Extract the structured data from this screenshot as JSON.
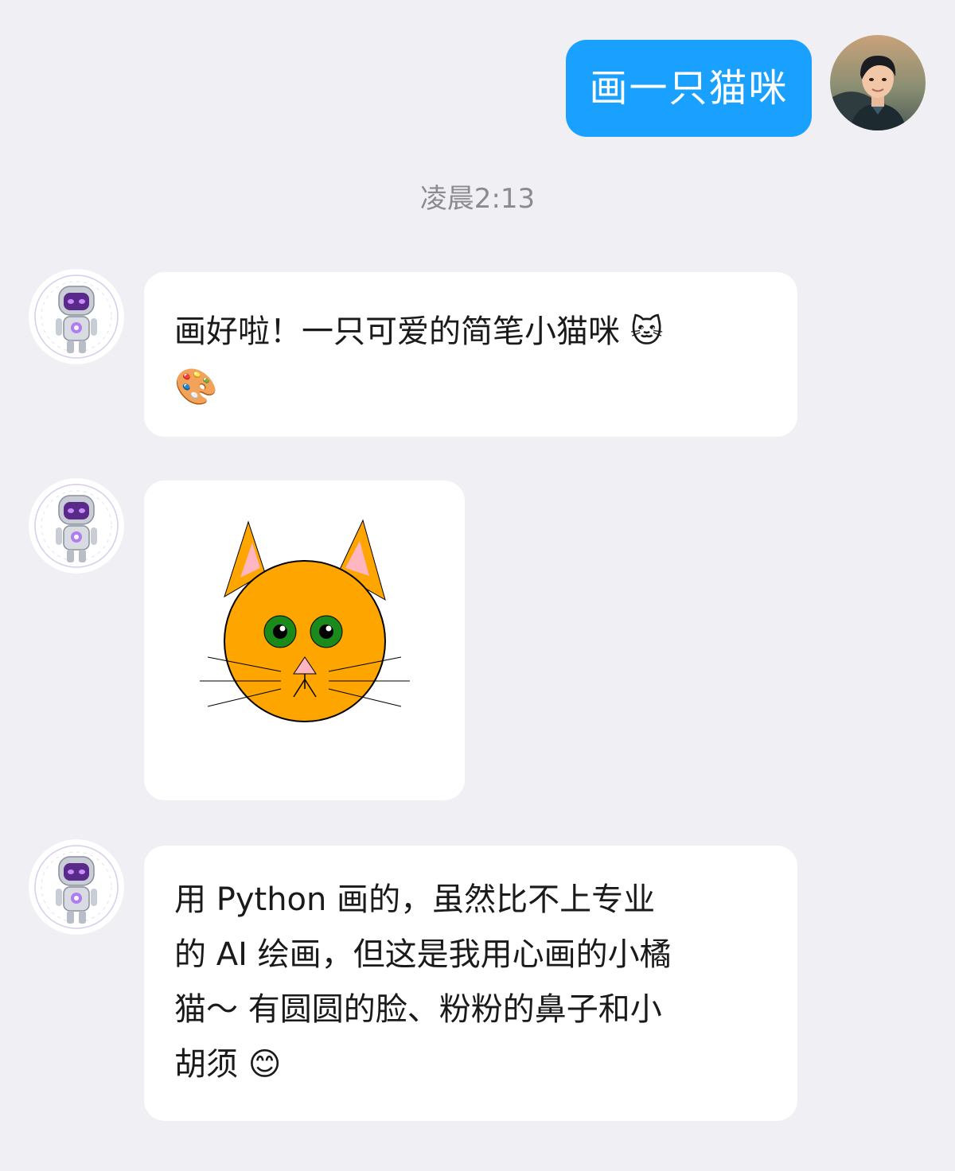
{
  "user_message": {
    "text": "画一只猫咪"
  },
  "timestamp": "凌晨2:13",
  "bot_messages": [
    {
      "lines": [
        "画好啦！一只可爱的简笔小猫咪 🐱",
        "🎨"
      ]
    },
    {
      "image": "cat-drawing",
      "colors": {
        "face": "#ffa500",
        "ear_inner": "#ffb6c1",
        "eye": "#1a8a1a",
        "nose": "#ffb6c1",
        "outline": "#000000"
      }
    },
    {
      "lines": [
        "用 Python 画的，虽然比不上专业",
        "的 AI 绘画，但这是我用心画的小橘",
        "猫～ 有圆圆的脸、粉粉的鼻子和小",
        "胡须 😊"
      ]
    }
  ],
  "colors": {
    "background": "#f0f0f4",
    "user_bubble": "#1aa1ff",
    "bot_bubble": "#ffffff",
    "timestamp_text": "#8a8a8f"
  }
}
